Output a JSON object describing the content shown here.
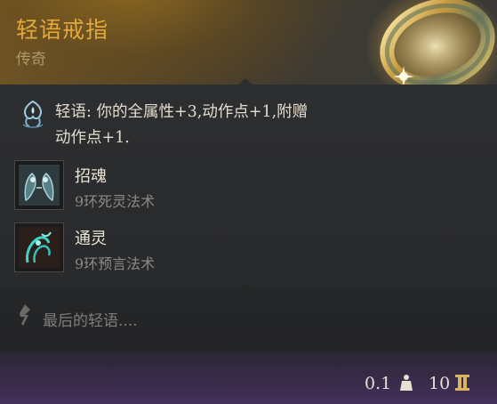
{
  "item": {
    "name": "轻语戒指",
    "rarity": "传奇",
    "icon": "gold-ring-icon"
  },
  "passive": {
    "icon": "whisper-passive-icon",
    "text_line1": "轻语: 你的全属性+3,动作点+1,附赠",
    "text_line2": "动作点+1."
  },
  "spells": [
    {
      "name": "招魂",
      "level": "9环死灵法术",
      "icon": "speak-with-dead-icon"
    },
    {
      "name": "通灵",
      "level": "9环预言法术",
      "icon": "commune-icon"
    }
  ],
  "flavor": {
    "icon": "quote-icon",
    "text": "最后的轻语...."
  },
  "footer": {
    "weight": "0.1",
    "weight_icon": "weight-icon",
    "value": "10",
    "value_icon": "gold-coin-icon"
  },
  "colors": {
    "title": "#e2a83c",
    "rarity": "#b0976c",
    "spell_name": "#ece4d4",
    "spell_sub": "#8c8a84",
    "flavor": "#7f7d78",
    "footer_bg": "#43305a"
  }
}
